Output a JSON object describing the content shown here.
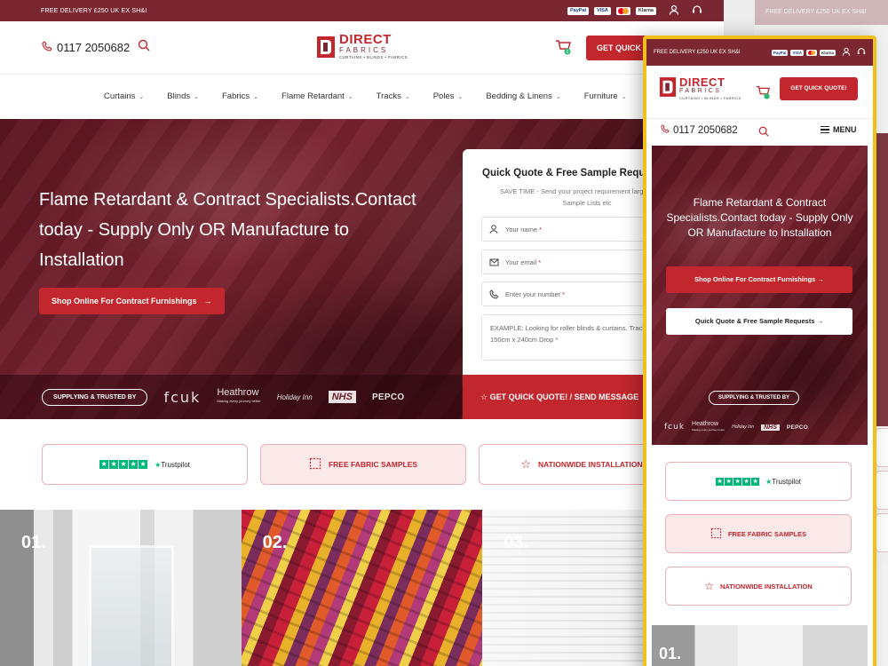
{
  "desktop": {
    "topbar": {
      "promo": "FREE DELIVERY £250 UK EX SH&I",
      "payments": [
        "PayPal",
        "VISA",
        "",
        "Klarna"
      ]
    },
    "header": {
      "phone": "0117 2050682",
      "logo_line1": "DIRECT",
      "logo_line2": "FABRICS",
      "logo_line3": "CURTAINS • BLINDS • FABRICS",
      "cart_count": "0",
      "cta": "GET QUICK"
    },
    "nav": [
      {
        "label": "Curtains"
      },
      {
        "label": "Blinds"
      },
      {
        "label": "Fabrics"
      },
      {
        "label": "Flame Retardant"
      },
      {
        "label": "Tracks"
      },
      {
        "label": "Poles"
      },
      {
        "label": "Bedding & Linens"
      },
      {
        "label": "Furniture"
      }
    ],
    "hero": {
      "title": "Flame Retardant & Contract Specialists.Contact today - Supply Only OR Manufacture to Installation",
      "button": "Shop Online For Contract Furnishings",
      "trusted_label": "SUPPLYING & TRUSTED BY",
      "brands": {
        "fcuk": "fcuk",
        "heathrow": "Heathrow",
        "heathrow_tag": "Making every journey better",
        "holiday_inn": "Holiday Inn",
        "nhs": "NHS",
        "pepco": "PEPCO"
      }
    },
    "quote": {
      "title": "Quick Quote & Free Sample Requ",
      "subtitle": "SAVE TIME - Send your project requirement large or small. Sample Lists etc",
      "name_placeholder": "Your name",
      "email_placeholder": "Your email",
      "phone_placeholder": "Enter your number",
      "required": "*",
      "message_placeholder": "EXAMPLE: Looking for roller blinds & curtains. Track width 150cm x 240cm Drop",
      "submit": "GET QUICK QUOTE! /  SEND MESSAGE"
    },
    "usps": {
      "trustpilot": "Trustpilot",
      "samples": "FREE FABRIC SAMPLES",
      "installation": "NATIONWIDE INSTALLATION"
    },
    "tiles": [
      "01.",
      "02.",
      "03."
    ]
  },
  "mobile": {
    "promo": "FREE DELIVERY £250 UK EX SH&I",
    "cta": "GET QUICK QUOTE!",
    "phone": "0117 2050682",
    "menu": "MENU",
    "hero_title": "Flame Retardant & Contract Specialists.Contact today - Supply Only OR Manufacture to Installation",
    "button_shop": "Shop Online For Contract Furnishings",
    "button_quote": "Quick Quote & Free Sample Requests",
    "trusted_label": "SUPPLYING & TRUSTED BY",
    "usp_samples": "FREE FABRIC SAMPLES",
    "usp_installation": "NATIONWIDE INSTALLATION",
    "tile": "01."
  },
  "colors": {
    "brand_red": "#c1272d",
    "maroon": "#7b2731",
    "highlight_border": "#f2c01a",
    "trustpilot_green": "#00b67a"
  }
}
